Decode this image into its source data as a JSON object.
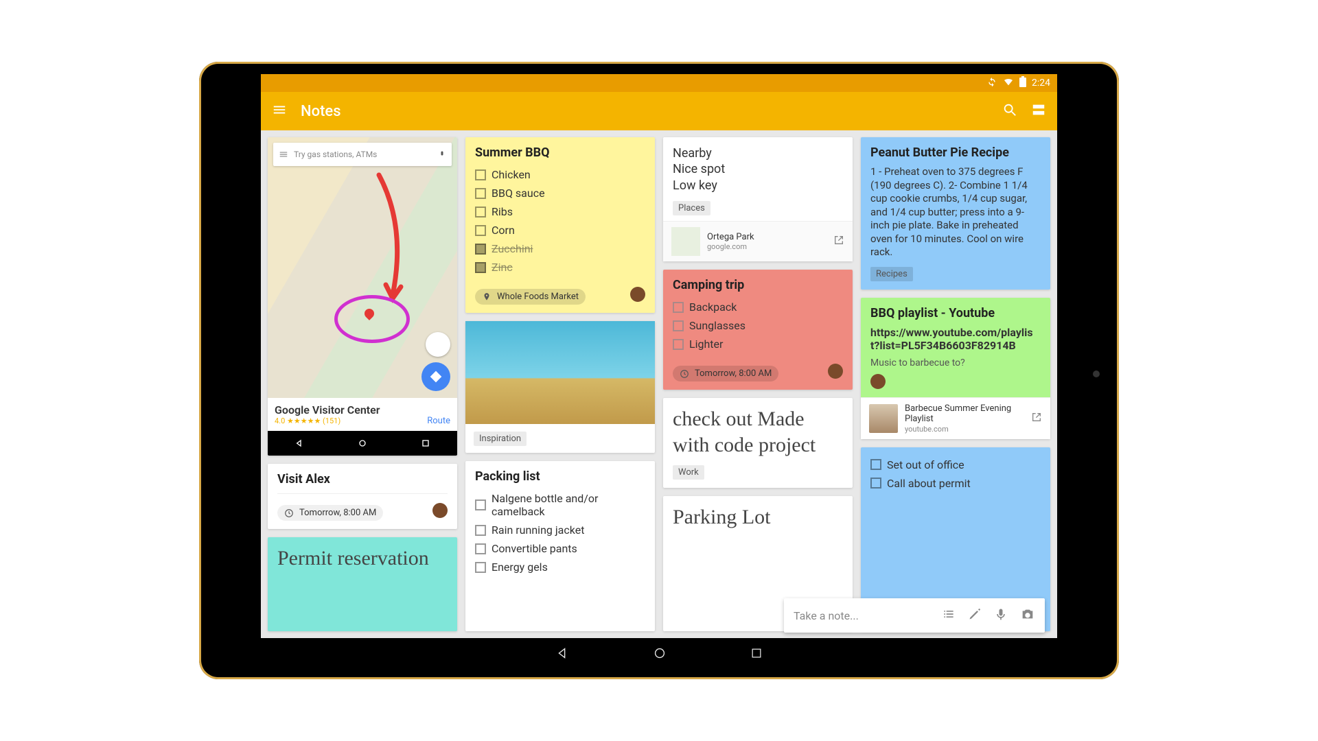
{
  "statusbar": {
    "time": "2:24"
  },
  "appbar": {
    "title": "Notes"
  },
  "compose": {
    "placeholder": "Take a note..."
  },
  "map_card": {
    "search_placeholder": "Try gas stations, ATMs",
    "place_title": "Google Visitor Center",
    "rating": "4.0 ★★★★★ (151)",
    "route_label": "Route"
  },
  "visit_card": {
    "title": "Visit Alex",
    "reminder": "Tomorrow, 8:00 AM"
  },
  "permit_card": {
    "title": "Permit reservation"
  },
  "bbq_card": {
    "title": "Summer BBQ",
    "items": [
      {
        "label": "Chicken",
        "checked": false
      },
      {
        "label": "BBQ sauce",
        "checked": false
      },
      {
        "label": "Ribs",
        "checked": false
      },
      {
        "label": "Corn",
        "checked": false
      },
      {
        "label": "Zucchini",
        "checked": true
      },
      {
        "label": "Zinc",
        "checked": true
      }
    ],
    "location": "Whole Foods Market"
  },
  "photo_card": {
    "tag": "Inspiration"
  },
  "packing_card": {
    "title": "Packing list",
    "items": [
      {
        "label": "Nalgene bottle and/or camelback",
        "checked": false
      },
      {
        "label": "Rain running jacket",
        "checked": false
      },
      {
        "label": "Convertible pants",
        "checked": false
      },
      {
        "label": "Energy gels",
        "checked": false
      }
    ]
  },
  "nearby_card": {
    "lines": [
      "Nearby",
      "Nice spot",
      "Low key"
    ],
    "tag": "Places",
    "link_title": "Ortega Park",
    "link_source": "google.com"
  },
  "camping_card": {
    "title": "Camping trip",
    "items": [
      {
        "label": "Backpack",
        "checked": false
      },
      {
        "label": "Sunglasses",
        "checked": false
      },
      {
        "label": "Lighter",
        "checked": false
      }
    ],
    "reminder": "Tomorrow, 8:00 AM"
  },
  "code_card": {
    "text": "check out Made with code project",
    "tag": "Work"
  },
  "parking_card": {
    "title": "Parking Lot"
  },
  "recipe_card": {
    "title": "Peanut Butter Pie Recipe",
    "body": "1 - Preheat oven to 375 degrees F (190 degrees C). 2- Combine 1 1/4 cup cookie crumbs, 1/4 cup sugar, and 1/4 cup butter; press into a 9-inch pie plate. Bake in preheated oven for 10 minutes. Cool on wire rack.",
    "tag": "Recipes"
  },
  "playlist_card": {
    "title": "BBQ playlist - Youtube",
    "url": "https://www.youtube.com/playlist?list=PL5F34B6603F82914B",
    "note": "Music to barbecue to?",
    "link_title": "Barbecue Summer Evening Playlist",
    "link_source": "youtube.com"
  },
  "todo_card": {
    "items": [
      {
        "label": "Set out of office",
        "checked": false
      },
      {
        "label": "Call about permit",
        "checked": false
      }
    ]
  }
}
